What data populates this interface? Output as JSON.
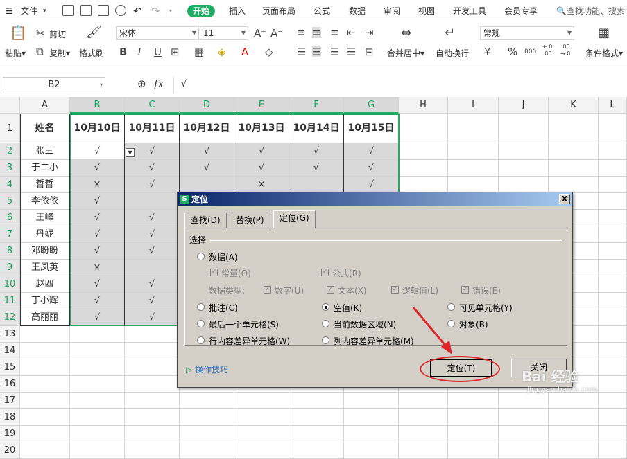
{
  "menubar": {
    "file": "文件",
    "tabs": [
      "开始",
      "插入",
      "页面布局",
      "公式",
      "数据",
      "审阅",
      "视图",
      "开发工具",
      "会员专享"
    ],
    "active_tab": "开始",
    "search_placeholder": "查找功能、搜索"
  },
  "ribbon": {
    "paste": "粘贴",
    "cut": "剪切",
    "copy": "复制",
    "format_painter": "格式刷",
    "font_name": "宋体",
    "font_size": "11",
    "merge_center": "合并居中",
    "wrap_text": "自动换行",
    "number_format": "常规",
    "conditional_format": "条件格式",
    "currency_symbol": "¥",
    "percent_symbol": "%",
    "thousands_symbol": "000",
    "decimal_add": "+.0\n.00",
    "decimal_remove": ".00\n→.0"
  },
  "formula_bar": {
    "name_box": "B2",
    "fx": "fx",
    "value": "√"
  },
  "sheet": {
    "columns": [
      "A",
      "B",
      "C",
      "D",
      "E",
      "F",
      "G",
      "H",
      "I",
      "J",
      "K",
      "L"
    ],
    "rows": [
      "1",
      "2",
      "3",
      "4",
      "5",
      "6",
      "7",
      "8",
      "9",
      "10",
      "11",
      "12",
      "13",
      "14",
      "15",
      "16",
      "17",
      "18",
      "19",
      "20"
    ],
    "header_row": [
      "姓名",
      "10月10日",
      "10月11日",
      "10月12日",
      "10月13日",
      "10月14日",
      "10月15日"
    ],
    "names": [
      "张三",
      "于二小",
      "哲哲",
      "李依依",
      "王峰",
      "丹妮",
      "邓盼盼",
      "王凤英",
      "赵四",
      "丁小辉",
      "高丽丽"
    ],
    "marks": [
      [
        "√",
        "√",
        "√",
        "√",
        "√",
        "√"
      ],
      [
        "√",
        "√",
        "√",
        "√",
        "√",
        "√"
      ],
      [
        "×",
        "√",
        "",
        "×",
        "",
        "√"
      ],
      [
        "√",
        "",
        "",
        "",
        "",
        ""
      ],
      [
        "√",
        "√",
        "",
        "",
        "",
        ""
      ],
      [
        "√",
        "√",
        "",
        "",
        "",
        ""
      ],
      [
        "√",
        "√",
        "",
        "",
        "",
        ""
      ],
      [
        "×",
        "",
        "",
        "",
        "",
        ""
      ],
      [
        "√",
        "√",
        "",
        "",
        "",
        ""
      ],
      [
        "√",
        "√",
        "",
        "",
        "",
        ""
      ],
      [
        "√",
        "√",
        "",
        "",
        "",
        ""
      ]
    ]
  },
  "dialog": {
    "title": "定位",
    "close": "X",
    "tabs": [
      "查找(D)",
      "替换(P)",
      "定位(G)"
    ],
    "section": "选择",
    "data": "数据(A)",
    "constant": "常量(O)",
    "formula": "公式(R)",
    "data_type": "数据类型:",
    "number": "数字(U)",
    "text": "文本(X)",
    "logical": "逻辑值(L)",
    "error": "错误(E)",
    "comment": "批注(C)",
    "blank": "空值(K)",
    "visible": "可见单元格(Y)",
    "last_cell": "最后一个单元格(S)",
    "current_region": "当前数据区域(N)",
    "object": "对象(B)",
    "row_diff": "行内容差异单元格(W)",
    "col_diff": "列内容差异单元格(M)",
    "tips": "操作技巧",
    "locate_btn": "定位(T)",
    "close_btn": "关闭"
  },
  "watermark": {
    "main": "Bai 经验",
    "sub": "jingyan.baidu.com"
  },
  "colors": {
    "accent": "#1fad64",
    "annotation": "#e0252a",
    "selection": "#d9d9d9"
  }
}
